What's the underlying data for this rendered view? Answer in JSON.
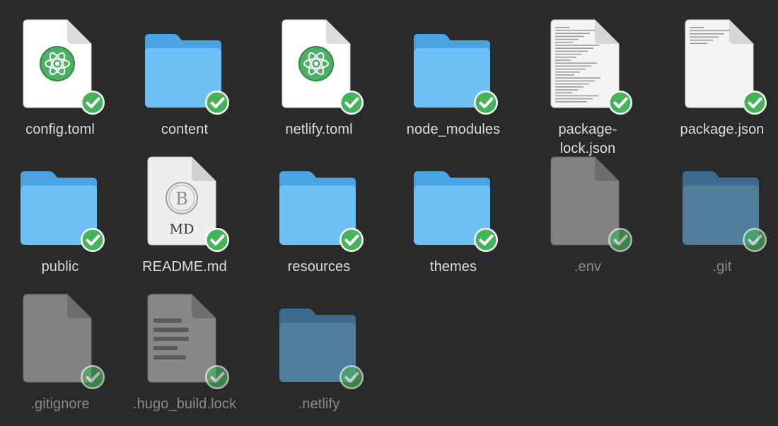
{
  "finder_icon_grid": {
    "items": [
      {
        "label": "config.toml",
        "kind": "atom-file",
        "hidden": false,
        "synced": true
      },
      {
        "label": "content",
        "kind": "folder",
        "hidden": false,
        "synced": true
      },
      {
        "label": "netlify.toml",
        "kind": "atom-file",
        "hidden": false,
        "synced": true
      },
      {
        "label": "node_modules",
        "kind": "folder",
        "hidden": false,
        "synced": true
      },
      {
        "label": "package-\nlock.json",
        "kind": "text-preview-file",
        "hidden": false,
        "synced": true
      },
      {
        "label": "package.json",
        "kind": "text-preview-file",
        "hidden": false,
        "synced": true
      },
      {
        "label": "public",
        "kind": "folder",
        "hidden": false,
        "synced": true
      },
      {
        "label": "README.md",
        "kind": "markdown-file",
        "badge_letter": "B",
        "badge_text": "MD",
        "hidden": false,
        "synced": true
      },
      {
        "label": "resources",
        "kind": "folder",
        "hidden": false,
        "synced": true
      },
      {
        "label": "themes",
        "kind": "folder",
        "hidden": false,
        "synced": true
      },
      {
        "label": ".env",
        "kind": "generic-file",
        "hidden": true,
        "synced": true
      },
      {
        "label": ".git",
        "kind": "folder",
        "hidden": true,
        "synced": true
      },
      {
        "label": ".gitignore",
        "kind": "generic-file",
        "hidden": true,
        "synced": true
      },
      {
        "label": ".hugo_build.lock",
        "kind": "lines-file",
        "hidden": true,
        "synced": true
      },
      {
        "label": ".netlify",
        "kind": "folder",
        "hidden": true,
        "synced": true
      }
    ]
  },
  "colors": {
    "background": "#2a2a2a",
    "folder_back": "#4aa3e3",
    "folder_front": "#6ec1f7",
    "sync_badge": "#44b35a",
    "label_text": "#dddddd",
    "hidden_label_text": "#8a8a8a"
  },
  "icons": {
    "atom-file": "atom-document-icon",
    "folder": "folder-icon",
    "text-preview-file": "text-document-icon",
    "markdown-file": "markdown-document-icon",
    "generic-file": "blank-document-icon",
    "lines-file": "document-lines-icon",
    "sync": "sync-check-icon"
  }
}
